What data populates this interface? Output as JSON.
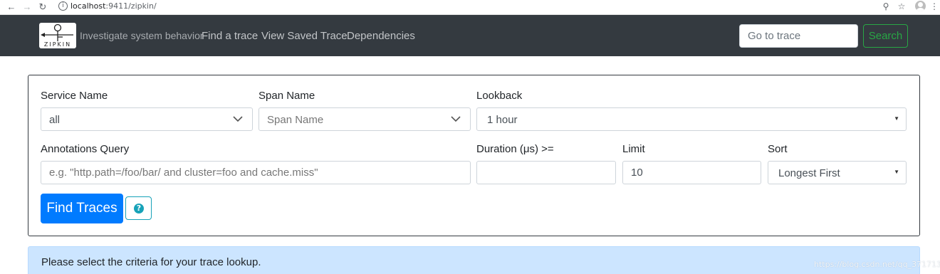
{
  "browser": {
    "url_host": "localhost",
    "url_rest": ":9411/zipkin/",
    "back_icon": "arrow-left-icon",
    "forward_icon": "arrow-right-icon",
    "reload_icon": "reload-icon",
    "info_icon": "info-icon",
    "zoom_icon": "zoom-icon",
    "bookmark_icon": "star-icon",
    "menu_icon": "kebab-menu-icon"
  },
  "navbar": {
    "logo_text": "ZIPKIN",
    "tagline": "Investigate system behavior",
    "links": [
      "Find a trace",
      "View Saved Trace",
      "Dependencies"
    ],
    "goto_placeholder": "Go to trace",
    "search_label": "Search",
    "background": "#343a40",
    "search_color": "#28a745"
  },
  "form": {
    "service_name": {
      "label": "Service Name",
      "value": "all"
    },
    "span_name": {
      "label": "Span Name",
      "value": "Span Name"
    },
    "lookback": {
      "label": "Lookback",
      "value": "1 hour"
    },
    "annotations": {
      "label": "Annotations Query",
      "placeholder": "e.g. \"http.path=/foo/bar/ and cluster=foo and cache.miss\""
    },
    "duration": {
      "label": "Duration (μs) >=",
      "value": ""
    },
    "limit": {
      "label": "Limit",
      "value": "10"
    },
    "sort": {
      "label": "Sort",
      "value": "Longest First"
    },
    "find_label": "Find Traces",
    "help_symbol": "?",
    "primary_color": "#007bff",
    "info_color": "#17a2b8"
  },
  "alert": {
    "message": "Please select the criteria for your trace lookup.",
    "background": "#cce5ff"
  },
  "watermark": "https://blog.csdn.net/qq_37171353"
}
